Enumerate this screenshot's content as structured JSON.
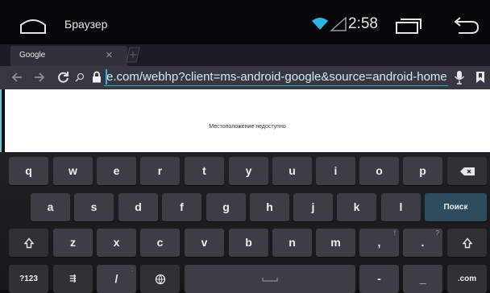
{
  "status_bar": {
    "app_title": "Браузер",
    "time": "2:58"
  },
  "tab": {
    "label": "Google",
    "close": "×"
  },
  "toolbar": {
    "url": "e.com/webhp?client=ms-android-google&source=android-home"
  },
  "page": {
    "message": "Местоположение недоступно"
  },
  "keyboard": {
    "row1": [
      "q",
      "w",
      "e",
      "r",
      "t",
      "y",
      "u",
      "i",
      "o",
      "p"
    ],
    "row2": [
      "a",
      "s",
      "d",
      "f",
      "g",
      "h",
      "j",
      "k",
      "l"
    ],
    "row3": [
      "z",
      "x",
      "c",
      "v",
      "b",
      "n",
      "m",
      ",",
      "."
    ],
    "row3_hints": [
      "!",
      "?"
    ],
    "row4": {
      "symbols": "?123",
      "mic_settings": "⇶",
      "slash": "/",
      "dash": "-",
      "underscore": "_",
      "dotcom": ".com",
      "hint_colon": ":"
    },
    "go_label": "Поиск"
  },
  "colors": {
    "accent": "#29a3c9",
    "key": "#3b3e45",
    "go_key": "#2d4d5e",
    "border": "#6fc2d8"
  }
}
